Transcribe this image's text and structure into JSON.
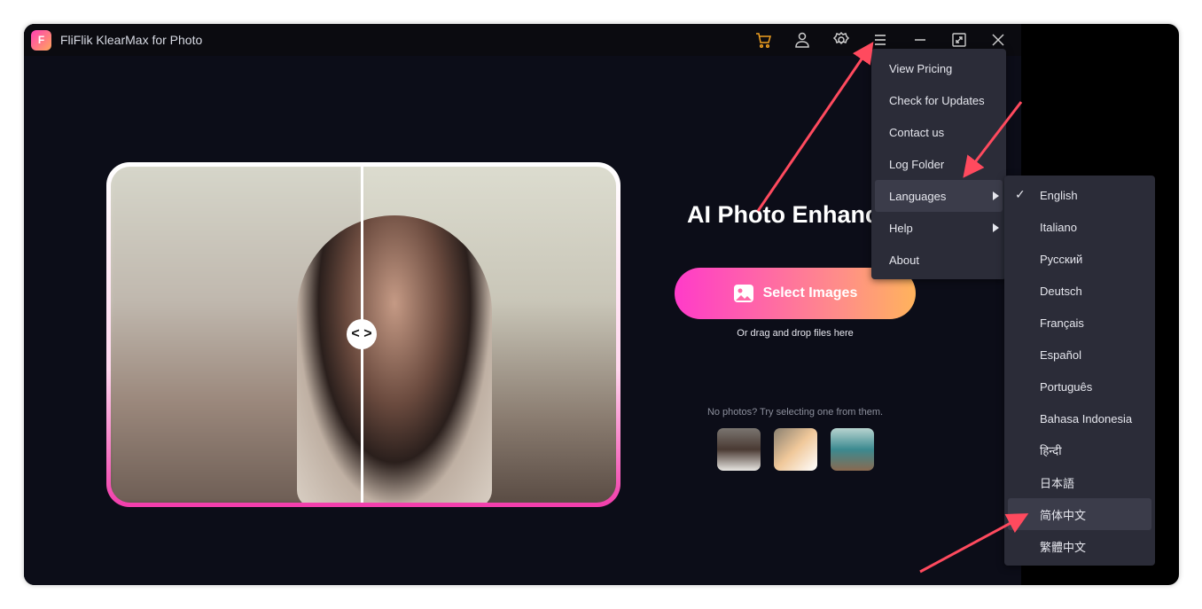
{
  "app": {
    "title": "FliFlik KlearMax for Photo",
    "logo_text": "F"
  },
  "titlebar": {
    "icons": [
      "cart-icon",
      "user-icon",
      "settings-icon",
      "menu-icon",
      "minimize-icon",
      "maximize-icon",
      "close-icon"
    ],
    "cart_color": "#f0a020"
  },
  "main": {
    "headline": "AI Photo Enhanc",
    "select_button": "Select Images",
    "drag_hint": "Or drag and drop files here",
    "sample_label": "No photos? Try selecting one from them.",
    "samples": [
      "woman-portrait",
      "cat",
      "mountain-lake"
    ],
    "compare_handle": "< >"
  },
  "menu": {
    "items": [
      {
        "label": "View Pricing"
      },
      {
        "label": "Check for Updates"
      },
      {
        "label": "Contact us"
      },
      {
        "label": "Log Folder"
      },
      {
        "label": "Languages",
        "submenu": true,
        "highlighted": true
      },
      {
        "label": "Help",
        "submenu": true
      },
      {
        "label": "About"
      }
    ]
  },
  "languages": {
    "selected": "English",
    "highlighted": "简体中文",
    "items": [
      "English",
      "Italiano",
      "Русский",
      "Deutsch",
      "Français",
      "Español",
      "Português",
      "Bahasa Indonesia",
      "हिन्दी",
      "日本語",
      "简体中文",
      "繁體中文"
    ]
  },
  "colors": {
    "accent_start": "#ff3bc9",
    "accent_end": "#ffb35c",
    "annotation": "#ff4a5e"
  }
}
